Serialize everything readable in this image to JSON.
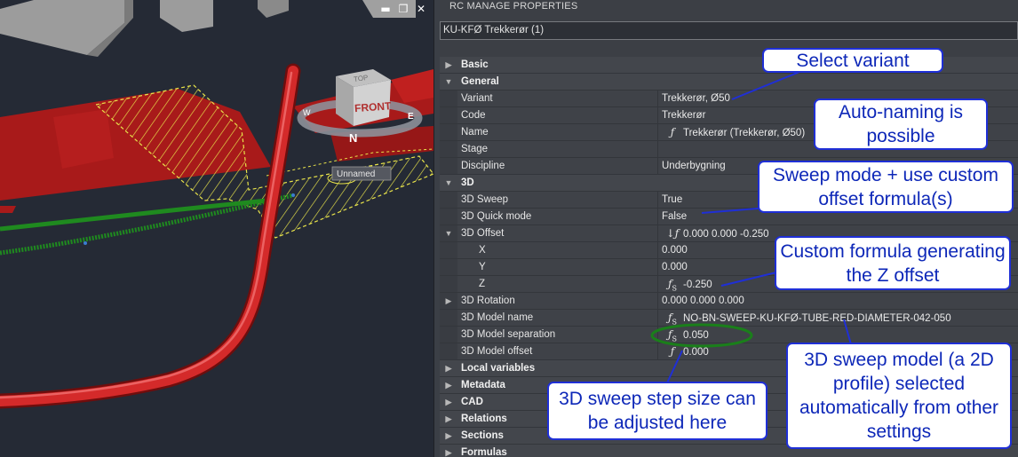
{
  "viewport": {
    "viewcube_face": "FRONT",
    "viewcube_top": "TOP",
    "compass_north": "N",
    "compass_west": "W",
    "compass_east": "E",
    "tooltip": "Unnamed",
    "window_controls": [
      "minimize-icon",
      "restore-icon",
      "close-icon"
    ],
    "colors": {
      "background": "#252a35",
      "pipe": "#cc1f1f",
      "surface": "#b01b1b",
      "hatch": "#e8e34a",
      "alignment": "#1f8a1f",
      "building": "#9a9a9a"
    }
  },
  "panel": {
    "title": "RC MANAGE PROPERTIES",
    "selection": "KU-KFØ Trekkerør (1)"
  },
  "grid": {
    "rows": [
      {
        "kind": "cat",
        "expand": "right",
        "label": "Basic"
      },
      {
        "kind": "cat",
        "expand": "down",
        "label": "General"
      },
      {
        "kind": "prop",
        "name": "Variant",
        "value": "Trekkerør, Ø50"
      },
      {
        "kind": "prop",
        "name": "Code",
        "value": "Trekkerør"
      },
      {
        "kind": "prop",
        "name": "Name",
        "fx": "f",
        "value": "Trekkerør (Trekkerør, Ø50)"
      },
      {
        "kind": "prop",
        "name": "Stage",
        "value": ""
      },
      {
        "kind": "prop",
        "name": "Discipline",
        "value": "Underbygning"
      },
      {
        "kind": "cat",
        "expand": "down",
        "label": "3D"
      },
      {
        "kind": "prop",
        "name": "3D Sweep",
        "value": "True"
      },
      {
        "kind": "prop",
        "name": "3D Quick mode",
        "value": "False"
      },
      {
        "kind": "prop",
        "name": "3D Offset",
        "expand": "down",
        "fx": "↓f",
        "value": "0.000 0.000 -0.250"
      },
      {
        "kind": "prop",
        "name": "X",
        "indent": true,
        "value": "0.000"
      },
      {
        "kind": "prop",
        "name": "Y",
        "indent": true,
        "value": "0.000"
      },
      {
        "kind": "prop",
        "name": "Z",
        "indent": true,
        "fx": "fS",
        "value": "-0.250"
      },
      {
        "kind": "prop",
        "name": "3D Rotation",
        "expand": "right",
        "value": "0.000 0.000 0.000"
      },
      {
        "kind": "prop",
        "name": "3D Model name",
        "fx": "fS",
        "value": "NO-BN-SWEEP-KU-KFØ-TUBE-RED-DIAMETER-042-050"
      },
      {
        "kind": "prop",
        "name": "3D Model separation",
        "fx": "fS",
        "value": "0.050"
      },
      {
        "kind": "prop",
        "name": "3D Model offset",
        "fx": "f",
        "value": "0.000"
      },
      {
        "kind": "cat",
        "expand": "right",
        "label": "Local variables"
      },
      {
        "kind": "cat",
        "expand": "right",
        "label": "Metadata"
      },
      {
        "kind": "cat",
        "expand": "right",
        "label": "CAD"
      },
      {
        "kind": "cat",
        "expand": "right",
        "label": "Relations"
      },
      {
        "kind": "cat",
        "expand": "right",
        "label": "Sections"
      },
      {
        "kind": "cat",
        "expand": "right",
        "label": "Formulas"
      }
    ]
  },
  "annotations": {
    "select_variant": "Select variant",
    "auto_naming": "Auto-naming is possible",
    "sweep_mode": "Sweep mode + use custom offset formula(s)",
    "custom_formula": "Custom formula generating the Z offset",
    "step_size": "3D sweep step size can be adjusted here",
    "sweep_model": "3D sweep model (a 2D profile) selected automatically from other settings",
    "colors": {
      "border": "#1f2fd6",
      "text": "#0d27b8",
      "highlight_ellipse": "#1a7f1a"
    }
  }
}
